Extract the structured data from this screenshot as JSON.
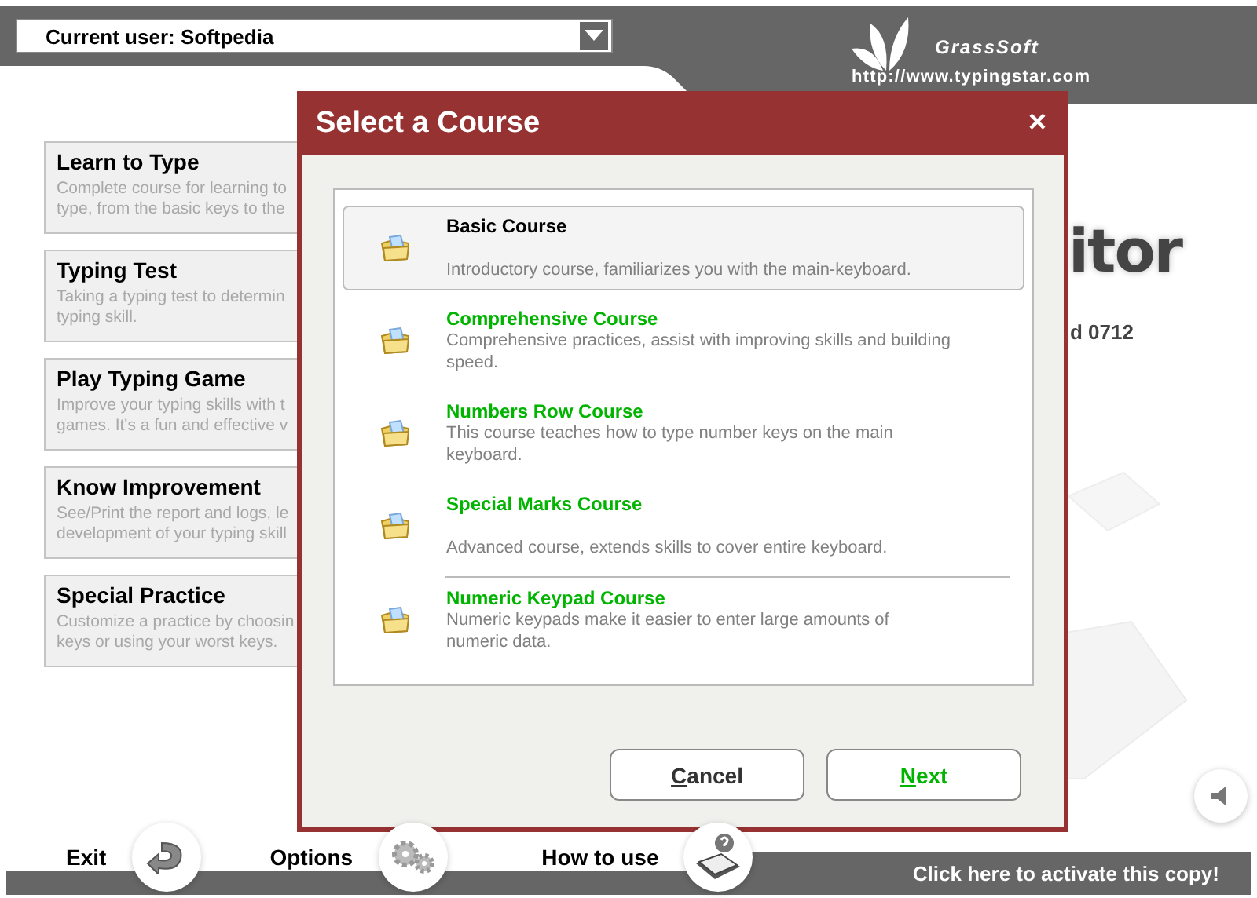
{
  "top_bar": {
    "user_select": {
      "value": "Current user: Softpedia"
    },
    "brand": {
      "name": "GrassSoft",
      "url": "http://www.typingstar.com"
    }
  },
  "menu": [
    {
      "title": "Learn to Type",
      "description_lines": [
        "Complete course for learning to",
        "type, from the basic keys to the"
      ]
    },
    {
      "title": "Typing Test",
      "description_lines": [
        "Taking a typing test to determin",
        "typing skill."
      ]
    },
    {
      "title": "Play Typing Game",
      "description_lines": [
        "Improve your typing skills with t",
        "games. It's a fun and effective v"
      ]
    },
    {
      "title": "Know Improvement",
      "description_lines": [
        "See/Print the report and logs, le",
        "development of your typing skill"
      ]
    },
    {
      "title": "Special Practice",
      "description_lines": [
        "Customize a practice by choosin",
        "keys or using your worst keys."
      ]
    }
  ],
  "background": {
    "logo_fragment": "itor",
    "version_fragment": "d 0712"
  },
  "dialog": {
    "title": "Select a Course",
    "close": "×",
    "courses": [
      {
        "title": "Basic Course",
        "description_lines": [
          "Introductory course, familiarizes you with the main-keyboard."
        ],
        "selected": true,
        "divider_above": false
      },
      {
        "title": "Comprehensive Course",
        "description_lines": [
          "Comprehensive practices, assist with improving skills and building",
          "speed."
        ],
        "selected": false,
        "divider_above": false
      },
      {
        "title": "Numbers Row Course",
        "description_lines": [
          "This course teaches how to type number keys on the main",
          "keyboard."
        ],
        "selected": false,
        "divider_above": false
      },
      {
        "title": "Special Marks Course",
        "description_lines": [
          "Advanced course, extends skills to cover entire keyboard."
        ],
        "selected": false,
        "divider_above": false
      },
      {
        "title": "Numeric Keypad Course",
        "description_lines": [
          "Numeric keypads make it easier to enter large amounts of",
          "numeric data."
        ],
        "selected": false,
        "divider_above": true
      }
    ],
    "buttons": [
      {
        "label": "Cancel",
        "kind": "cancel"
      },
      {
        "label": "Next",
        "kind": "next"
      }
    ]
  },
  "bottom_nav": [
    {
      "label": "Exit",
      "kind": "exit"
    },
    {
      "label": "Options",
      "kind": "options"
    },
    {
      "label": "How to use",
      "kind": "help"
    }
  ],
  "activate_link": "Click here to activate this copy!"
}
